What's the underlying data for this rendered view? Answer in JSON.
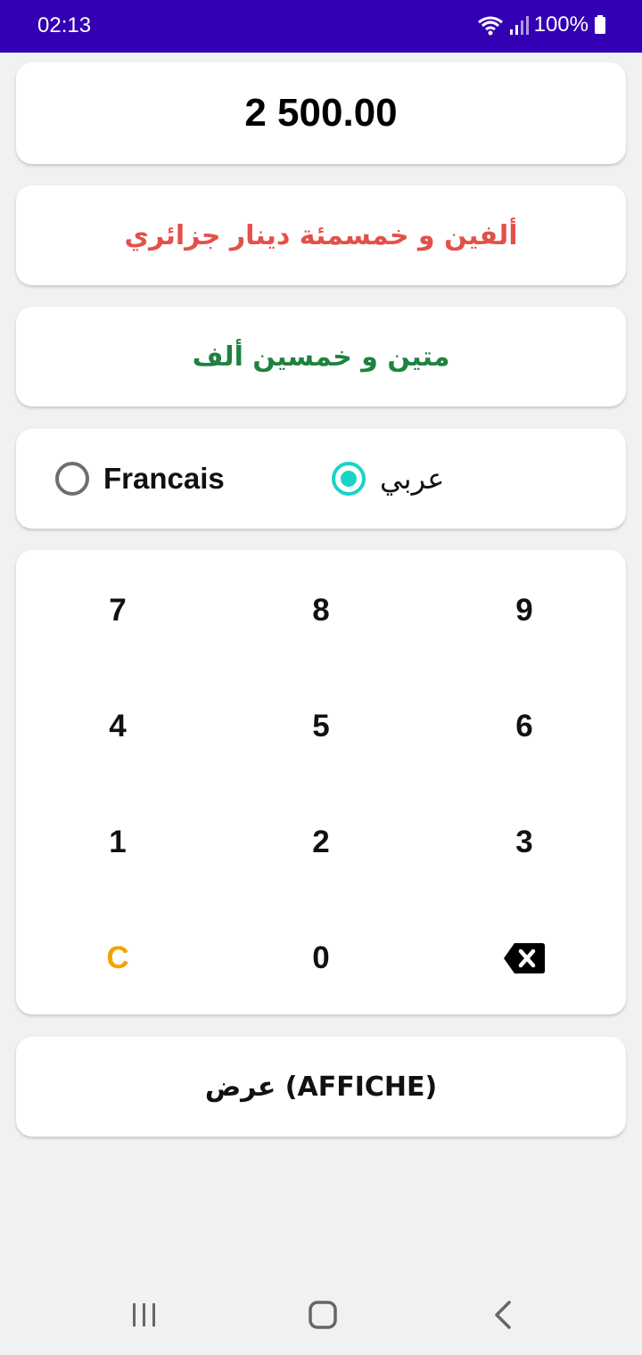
{
  "status_bar": {
    "time": "02:13",
    "battery": "100%",
    "icons": [
      "wifi-icon",
      "signal-icon",
      "battery-icon"
    ]
  },
  "amount": {
    "value": "2 500.00"
  },
  "words_primary": {
    "text": "ألفين و خمسمئة دينار جزائري",
    "color": "#e25149"
  },
  "words_secondary": {
    "text": "متين و خمسين ألف",
    "color": "#1f8240"
  },
  "language": {
    "options": [
      {
        "label": "Francais",
        "selected": false
      },
      {
        "label": "عربي",
        "selected": true
      }
    ],
    "accent": "#19d3c5"
  },
  "keypad": {
    "keys": [
      "7",
      "8",
      "9",
      "4",
      "5",
      "6",
      "1",
      "2",
      "3",
      "C",
      "0",
      "backspace"
    ],
    "clear_color": "#f0a500"
  },
  "show_button": {
    "label": "عرض (AFFICHE)"
  },
  "colors": {
    "status_bar": "#3300b3",
    "background": "#f0f1f3"
  },
  "nav_bar": {
    "icons": [
      "recent-apps-icon",
      "home-icon",
      "back-icon"
    ]
  }
}
